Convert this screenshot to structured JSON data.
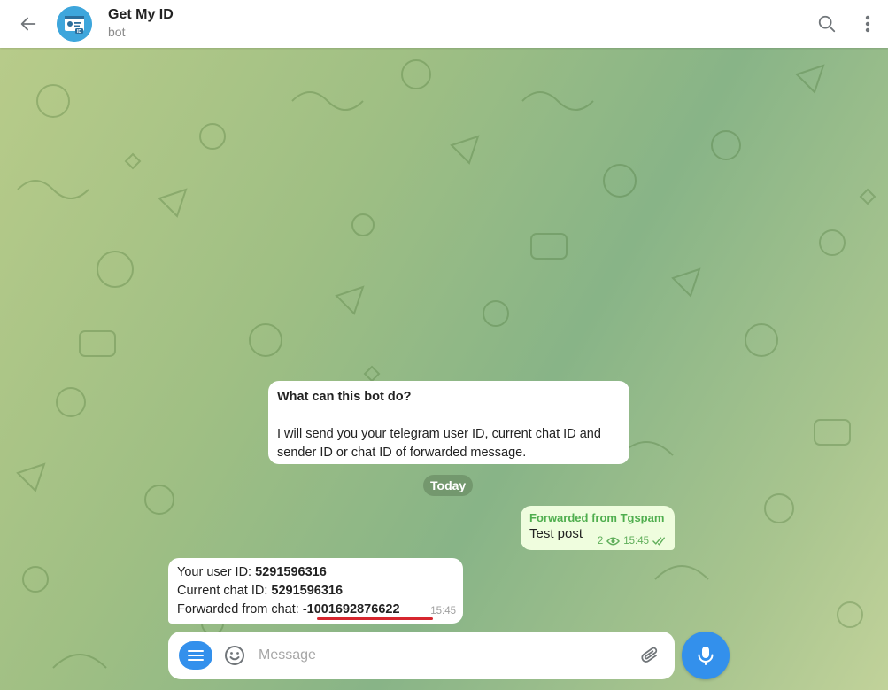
{
  "header": {
    "title": "Get My ID",
    "subtitle": "bot",
    "icons": {
      "back": "arrow-left-icon",
      "search": "search-icon",
      "more": "more-vertical-icon"
    }
  },
  "info_card": {
    "title": "What can this bot do?",
    "text": "I will send you your telegram user ID, current chat ID and sender ID or chat ID of forwarded message."
  },
  "date_separator": "Today",
  "outgoing_message": {
    "forwarded_label": "Forwarded from Tgspam",
    "text": "Test post",
    "views": "2",
    "time": "15:45"
  },
  "incoming_message": {
    "user_id_label": "Your user ID:",
    "user_id": "5291596316",
    "chat_id_label": "Current chat ID:",
    "chat_id": "5291596316",
    "forwarded_label": "Forwarded from chat:",
    "forwarded_chat_id": "-1001692876622",
    "time": "15:45"
  },
  "composer": {
    "placeholder": "Message"
  },
  "colors": {
    "accent": "#3390ec",
    "outgoing_bubble": "#effdde",
    "forward_label": "#4fae4e",
    "underline": "#d6262e"
  }
}
